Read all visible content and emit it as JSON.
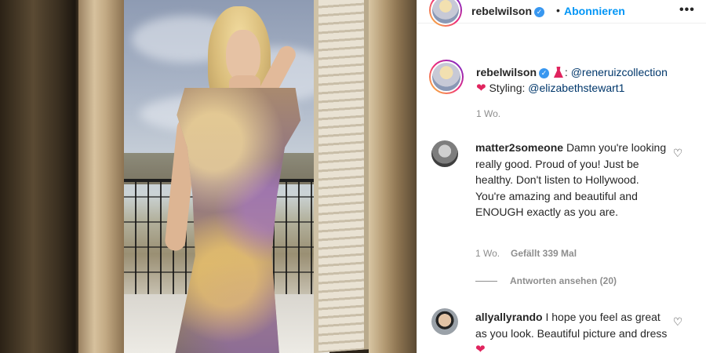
{
  "post": {
    "username": "rebelwilson",
    "follow_label": "Abonnieren",
    "more_label": "•••",
    "dot": "•",
    "verified_mark": "✓"
  },
  "caption": {
    "username": "rebelwilson",
    "mention_1": "@reneruizcollection",
    "styling_label": "Styling:",
    "mention_2": "@elizabethstewart1",
    "time": "1 Wo."
  },
  "comments": [
    {
      "username": "matter2someone",
      "text": "Damn you're looking really good. Proud of you! Just be healthy. Don't listen to Hollywood. You're amazing and beautiful and ENOUGH exactly as you are.",
      "time": "1 Wo.",
      "likes": "Gefällt 339 Mal",
      "replies": "Antworten ansehen (20)"
    },
    {
      "username": "allyallyrando",
      "text": "I hope you feel as great as you look. Beautiful picture and dress"
    }
  ],
  "icons": {
    "heart_outline": "♡",
    "heart_filled": "❤"
  },
  "colors": {
    "link": "#00376b",
    "follow": "#0095f6",
    "verified": "#3897f0",
    "heart": "#e0245e",
    "meta": "#8e8e8e"
  }
}
